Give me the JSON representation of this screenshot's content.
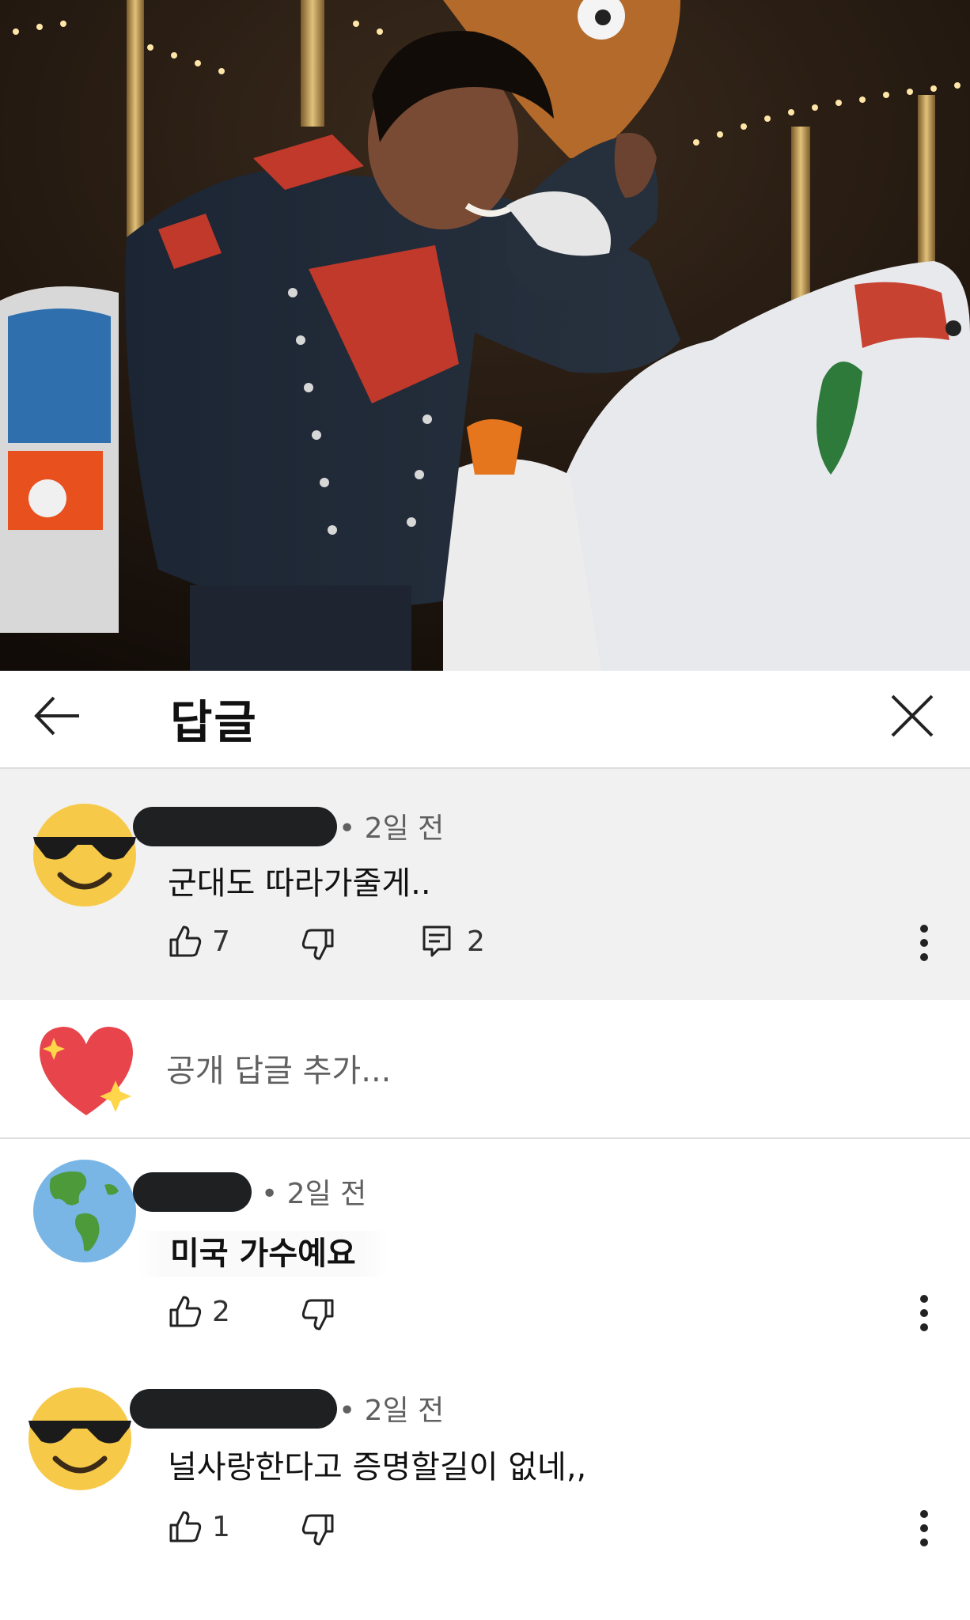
{
  "header": {
    "title": "답글"
  },
  "icons": {
    "back": "arrow-left-icon",
    "close": "close-icon",
    "like": "thumb-up-icon",
    "dislike": "thumb-down-icon",
    "reply": "reply-icon",
    "more": "more-vert-icon"
  },
  "parent_comment": {
    "avatar": "sunglasses-emoji",
    "timestamp": "• 2일 전",
    "text": "군대도 따라가줄게..",
    "likes": "7",
    "replies": "2"
  },
  "reply_box": {
    "avatar": "sparkling-heart-emoji",
    "placeholder": "공개 답글 추가..."
  },
  "replies": [
    {
      "avatar": "globe-americas-emoji",
      "timestamp": "• 2일 전",
      "text": "미국 가수예요",
      "likes": "2"
    },
    {
      "avatar": "sunglasses-emoji",
      "timestamp": "• 2일 전",
      "text": "널사랑한다고 증명할길이 없네,,",
      "likes": "1"
    }
  ],
  "colors": {
    "parent_bg": "#f1f1f1",
    "name_redaction": "#1f2022",
    "secondary_text": "#606060"
  }
}
